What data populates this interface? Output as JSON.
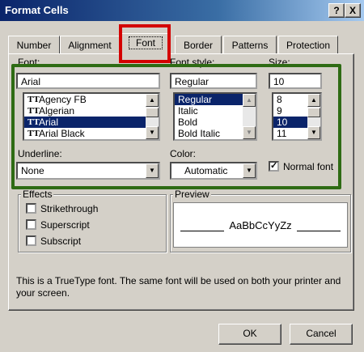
{
  "window": {
    "title": "Format Cells",
    "help_label": "?",
    "close_label": "X"
  },
  "tabs": [
    "Number",
    "Alignment",
    "Font",
    "Border",
    "Patterns",
    "Protection"
  ],
  "font": {
    "label": "Font:",
    "value": "Arial",
    "list": [
      "Agency FB",
      "Algerian",
      "Arial",
      "Arial Black"
    ],
    "selected": "Arial"
  },
  "font_style": {
    "label": "Font style:",
    "value": "Regular",
    "list": [
      "Regular",
      "Italic",
      "Bold",
      "Bold Italic"
    ],
    "selected": "Regular"
  },
  "size": {
    "label": "Size:",
    "value": "10",
    "list": [
      "8",
      "9",
      "10",
      "11"
    ],
    "selected": "10"
  },
  "underline": {
    "label": "Underline:",
    "value": "None"
  },
  "color": {
    "label": "Color:",
    "value": "Automatic"
  },
  "normal_font": {
    "label": "Normal font",
    "checked": true
  },
  "effects": {
    "label": "Effects",
    "items": [
      {
        "label": "Strikethrough",
        "checked": false
      },
      {
        "label": "Superscript",
        "checked": false
      },
      {
        "label": "Subscript",
        "checked": false
      }
    ]
  },
  "preview": {
    "label": "Preview",
    "sample": "AaBbCcYyZz"
  },
  "info_text": "This is a TrueType font.  The same font will be used on both your printer and your screen.",
  "buttons": {
    "ok": "OK",
    "cancel": "Cancel"
  },
  "highlights": {
    "tab_outline_color": "#d40000",
    "options_outline_color": "#2e6b14"
  },
  "icons": {
    "truetype": "truetype-font-icon",
    "scroll_up": "scroll-up-icon",
    "scroll_down": "scroll-down-icon",
    "dropdown": "dropdown-arrow-icon"
  }
}
